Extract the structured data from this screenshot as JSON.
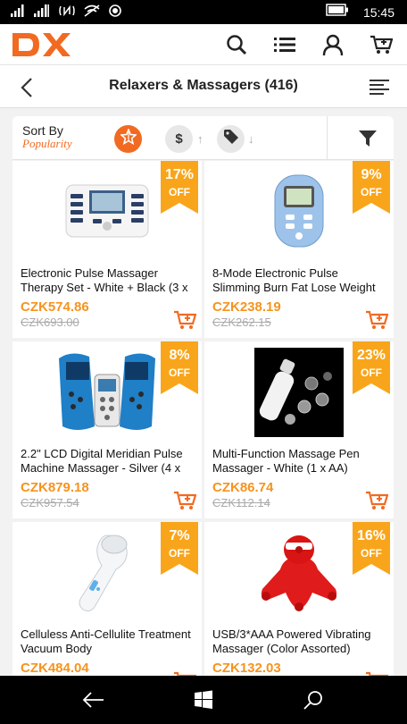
{
  "status_bar": {
    "time": "15:45"
  },
  "header": {
    "logo_text": "DX",
    "brand_color": "#f26a21"
  },
  "title_bar": {
    "title": "Relaxers & Massagers (416)"
  },
  "sort": {
    "label": "Sort By",
    "value": "Popularity",
    "price_symbol": "$",
    "up_arrow": "↑",
    "down_arrow": "↓"
  },
  "products": [
    {
      "name": "Electronic Pulse Massager Therapy Set - White + Black (3 x",
      "price": "CZK574.86",
      "old_price": "CZK693.00",
      "discount": "17%",
      "off": "OFF"
    },
    {
      "name": "8-Mode Electronic Pulse Slimming Burn Fat Lose Weight",
      "price": "CZK238.19",
      "old_price": "CZK262.15",
      "discount": "9%",
      "off": "OFF"
    },
    {
      "name": "2.2\" LCD Digital Meridian Pulse Machine Massager - Silver (4 x",
      "price": "CZK879.18",
      "old_price": "CZK957.54",
      "discount": "8%",
      "off": "OFF"
    },
    {
      "name": "Multi-Function Massage Pen Massager - White (1 x AA)",
      "price": "CZK86.74",
      "old_price": "CZK112.14",
      "discount": "23%",
      "off": "OFF"
    },
    {
      "name": "Celluless Anti-Cellulite Treatment Vacuum Body",
      "price": "CZK484.04",
      "old_price": "",
      "discount": "7%",
      "off": "OFF"
    },
    {
      "name": "USB/3*AAA Powered Vibrating Massager (Color Assorted)",
      "price": "CZK132.03",
      "old_price": "",
      "discount": "16%",
      "off": "OFF"
    }
  ],
  "colors": {
    "badge": "#f9a51b",
    "price": "#f7931e",
    "accent": "#f26a21"
  }
}
